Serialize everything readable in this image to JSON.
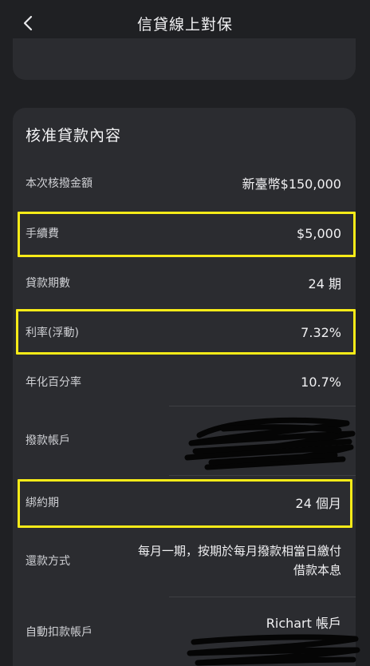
{
  "header": {
    "title": "信貸線上對保",
    "back_icon": "chevron-left-icon"
  },
  "loan_section": {
    "title": "核准貸款內容",
    "rows": {
      "amount": {
        "label": "本次核撥金額",
        "value": "新臺幣$150,000"
      },
      "fee": {
        "label": "手續費",
        "value": "$5,000"
      },
      "periods": {
        "label": "貸款期數",
        "value": "24 期"
      },
      "rate": {
        "label": "利率(浮動)",
        "value": "7.32%"
      },
      "apr": {
        "label": "年化百分率",
        "value": "10.7%"
      },
      "disburse_account": {
        "label": "撥款帳戶",
        "value": ""
      },
      "lock_period": {
        "label": "綁約期",
        "value": "24 個月"
      },
      "repay_method": {
        "label": "還款方式",
        "value_line1": "每月一期，按期於每月撥款相當日繳付",
        "value_line2": "借款本息"
      },
      "debit_account": {
        "label": "自動扣款帳戶",
        "value": "Richart 帳戶"
      }
    }
  },
  "colors": {
    "background": "#1f2023",
    "card": "#2b2c30",
    "highlight": "#f7eb18",
    "text": "#f0f0f2"
  }
}
